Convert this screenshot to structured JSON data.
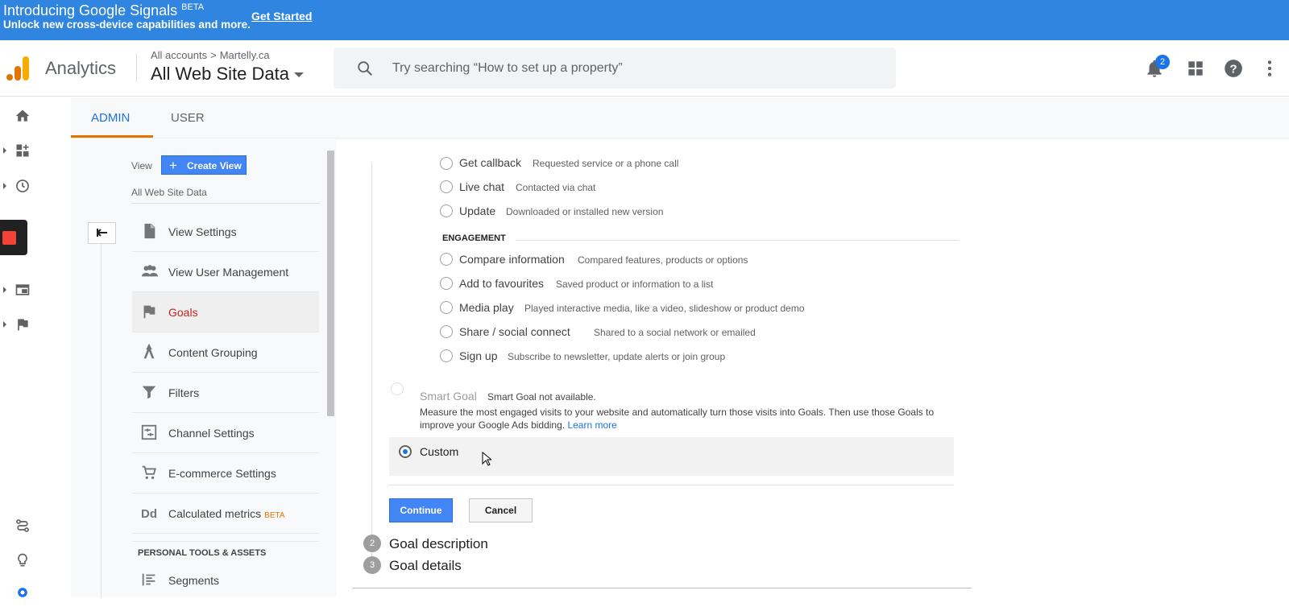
{
  "banner": {
    "title": "Introducing Google Signals",
    "beta": "BETA",
    "subtitle": "Unlock new cross-device capabilities and more.",
    "cta": "Get Started"
  },
  "header": {
    "app_name": "Analytics",
    "breadcrumb": [
      "All accounts",
      "Martelly.ca"
    ],
    "breadcrumb_sep": ">",
    "view_name": "All Web Site Data",
    "search_placeholder": "Try searching “How to set up a property”",
    "notifications_count": "2",
    "icons": [
      "search-icon",
      "bell-icon",
      "apps-grid-icon",
      "help-icon",
      "more-vert-icon"
    ]
  },
  "tabs": [
    {
      "label": "ADMIN",
      "active": true
    },
    {
      "label": "USER",
      "active": false
    }
  ],
  "admin_column": {
    "view_label": "View",
    "create_view_label": "Create View",
    "view_name": "All Web Site Data",
    "menu": [
      {
        "label": "View Settings",
        "icon": "document-icon"
      },
      {
        "label": "View User Management",
        "icon": "people-icon"
      },
      {
        "label": "Goals",
        "icon": "flag-icon",
        "active": true
      },
      {
        "label": "Content Grouping",
        "icon": "content-grouping-icon"
      },
      {
        "label": "Filters",
        "icon": "filter-icon"
      },
      {
        "label": "Channel Settings",
        "icon": "channel-settings-icon"
      },
      {
        "label": "E-commerce Settings",
        "icon": "cart-icon"
      },
      {
        "label": "Calculated metrics",
        "icon": "calculated-metrics-icon",
        "badge": "BETA"
      }
    ],
    "section_title": "PERSONAL TOOLS & ASSETS",
    "section_items": [
      {
        "label": "Segments",
        "icon": "segments-icon"
      }
    ]
  },
  "goal_form": {
    "cut_option": {
      "label": "Get callback",
      "desc": "Requested service or a phone call"
    },
    "inquiry_options": [
      {
        "label": "Live chat",
        "desc": "Contacted via chat"
      },
      {
        "label": "Update",
        "desc": "Downloaded or installed new version"
      }
    ],
    "engagement_title": "ENGAGEMENT",
    "engagement_options": [
      {
        "label": "Compare information",
        "desc": "Compared features, products or options"
      },
      {
        "label": "Add to favourites",
        "desc": "Saved product or information to a list"
      },
      {
        "label": "Media play",
        "desc": "Played interactive media, like a video, slideshow or product demo"
      },
      {
        "label": "Share / social connect",
        "desc": "Shared to a social network or emailed"
      },
      {
        "label": "Sign up",
        "desc": "Subscribe to newsletter, update alerts or join group"
      }
    ],
    "smart_goal": {
      "label": "Smart Goal",
      "status": "Smart Goal not available.",
      "desc": "Measure the most engaged visits to your website and automatically turn those visits into Goals. Then use those Goals to improve your Google Ads bidding.",
      "learn_more": "Learn more"
    },
    "custom": {
      "label": "Custom",
      "selected": true
    },
    "continue_label": "Continue",
    "cancel_label": "Cancel",
    "steps": [
      {
        "num": "2",
        "title": "Goal description"
      },
      {
        "num": "3",
        "title": "Goal details"
      }
    ]
  },
  "colors": {
    "banner_blue": "#2f85e0",
    "accent_blue": "#1a73e8",
    "button_blue": "#4285f4",
    "orange": "#e37400",
    "active_goal_red": "#c5221f"
  }
}
